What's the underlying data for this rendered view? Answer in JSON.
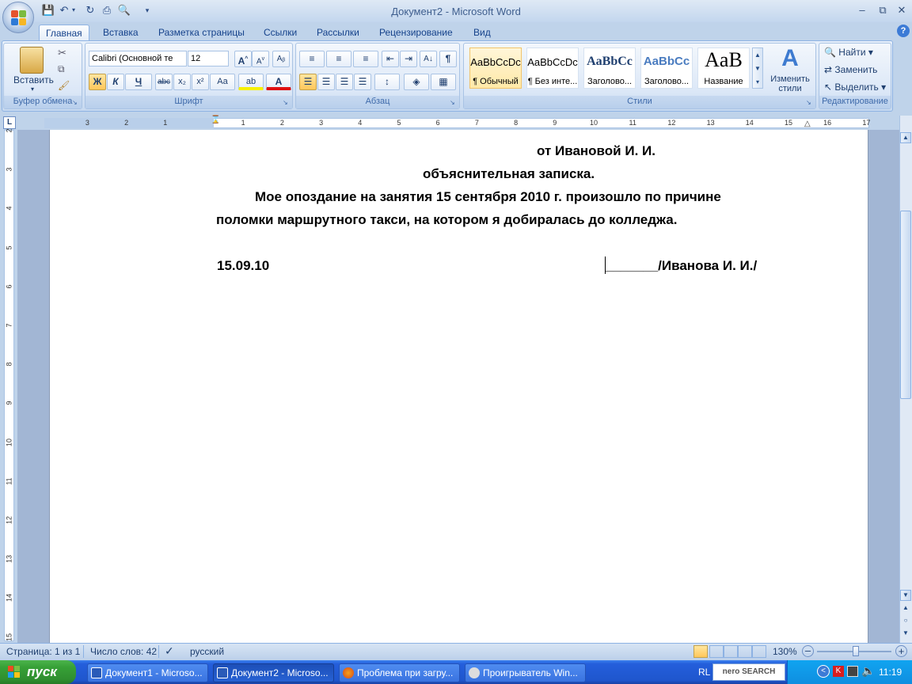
{
  "window": {
    "title": "Документ2 - Microsoft Word"
  },
  "qat": {
    "save": "save-icon",
    "undo": "undo-icon",
    "redo": "redo-icon",
    "print": "print-icon",
    "preview": "print-preview-icon"
  },
  "tabs": [
    {
      "label": "Главная",
      "active": true
    },
    {
      "label": "Вставка"
    },
    {
      "label": "Разметка страницы"
    },
    {
      "label": "Ссылки"
    },
    {
      "label": "Рассылки"
    },
    {
      "label": "Рецензирование"
    },
    {
      "label": "Вид"
    }
  ],
  "ribbon": {
    "clipboard": {
      "label": "Буфер обмена",
      "paste": "Вставить"
    },
    "font": {
      "label": "Шрифт",
      "font_name": "Calibri (Основной те",
      "font_size": "12",
      "bold": "Ж",
      "italic": "К",
      "underline": "Ч",
      "strike": "abc",
      "sub": "x₂",
      "sup": "x²",
      "case": "Aa"
    },
    "paragraph": {
      "label": "Абзац"
    },
    "styles": {
      "label": "Стили",
      "items": [
        {
          "sample": "AaBbCcDc",
          "name": "¶ Обычный"
        },
        {
          "sample": "AaBbCcDc",
          "name": "¶ Без инте..."
        },
        {
          "sample": "AaBbCc",
          "name": "Заголово..."
        },
        {
          "sample": "AaBbCc",
          "name": "Заголово..."
        },
        {
          "sample": "AaB",
          "name": "Название"
        }
      ],
      "change_styles": "Изменить стили"
    },
    "editing": {
      "label": "Редактирование",
      "find": "Найти",
      "replace": "Заменить",
      "select": "Выделить"
    }
  },
  "ruler": {
    "h_numbers": [
      "3",
      "2",
      "1",
      "1",
      "2",
      "3",
      "4",
      "5",
      "6",
      "7",
      "8",
      "9",
      "10",
      "11",
      "12",
      "13",
      "14",
      "15",
      "16",
      "17"
    ],
    "v_numbers": [
      "2",
      "3",
      "4",
      "5",
      "6",
      "7",
      "8",
      "9",
      "10",
      "11",
      "12",
      "13",
      "14",
      "15"
    ]
  },
  "document": {
    "line1": "от Ивановой  И. И.",
    "line2": "объяснительная записка.",
    "line3": "Мое опоздание на занятия 15 сентября 2010 г. произошло по причине",
    "line4": "поломки маршрутного такси, на котором я добиралась до колледжа.",
    "date": "15.09.10",
    "signature": "_______/Иванова  И. И./"
  },
  "status": {
    "page": "Страница: 1 из 1",
    "words": "Число слов: 42",
    "lang": "русский",
    "zoom": "130%"
  },
  "taskbar": {
    "start": "пуск",
    "tasks": [
      "Документ1 - Microso...",
      "Документ2 - Microso...",
      "Проблема при загру...",
      "Проигрыватель Win..."
    ],
    "lang": "RL",
    "search": "nero SEARCH",
    "clock": "11:19"
  }
}
